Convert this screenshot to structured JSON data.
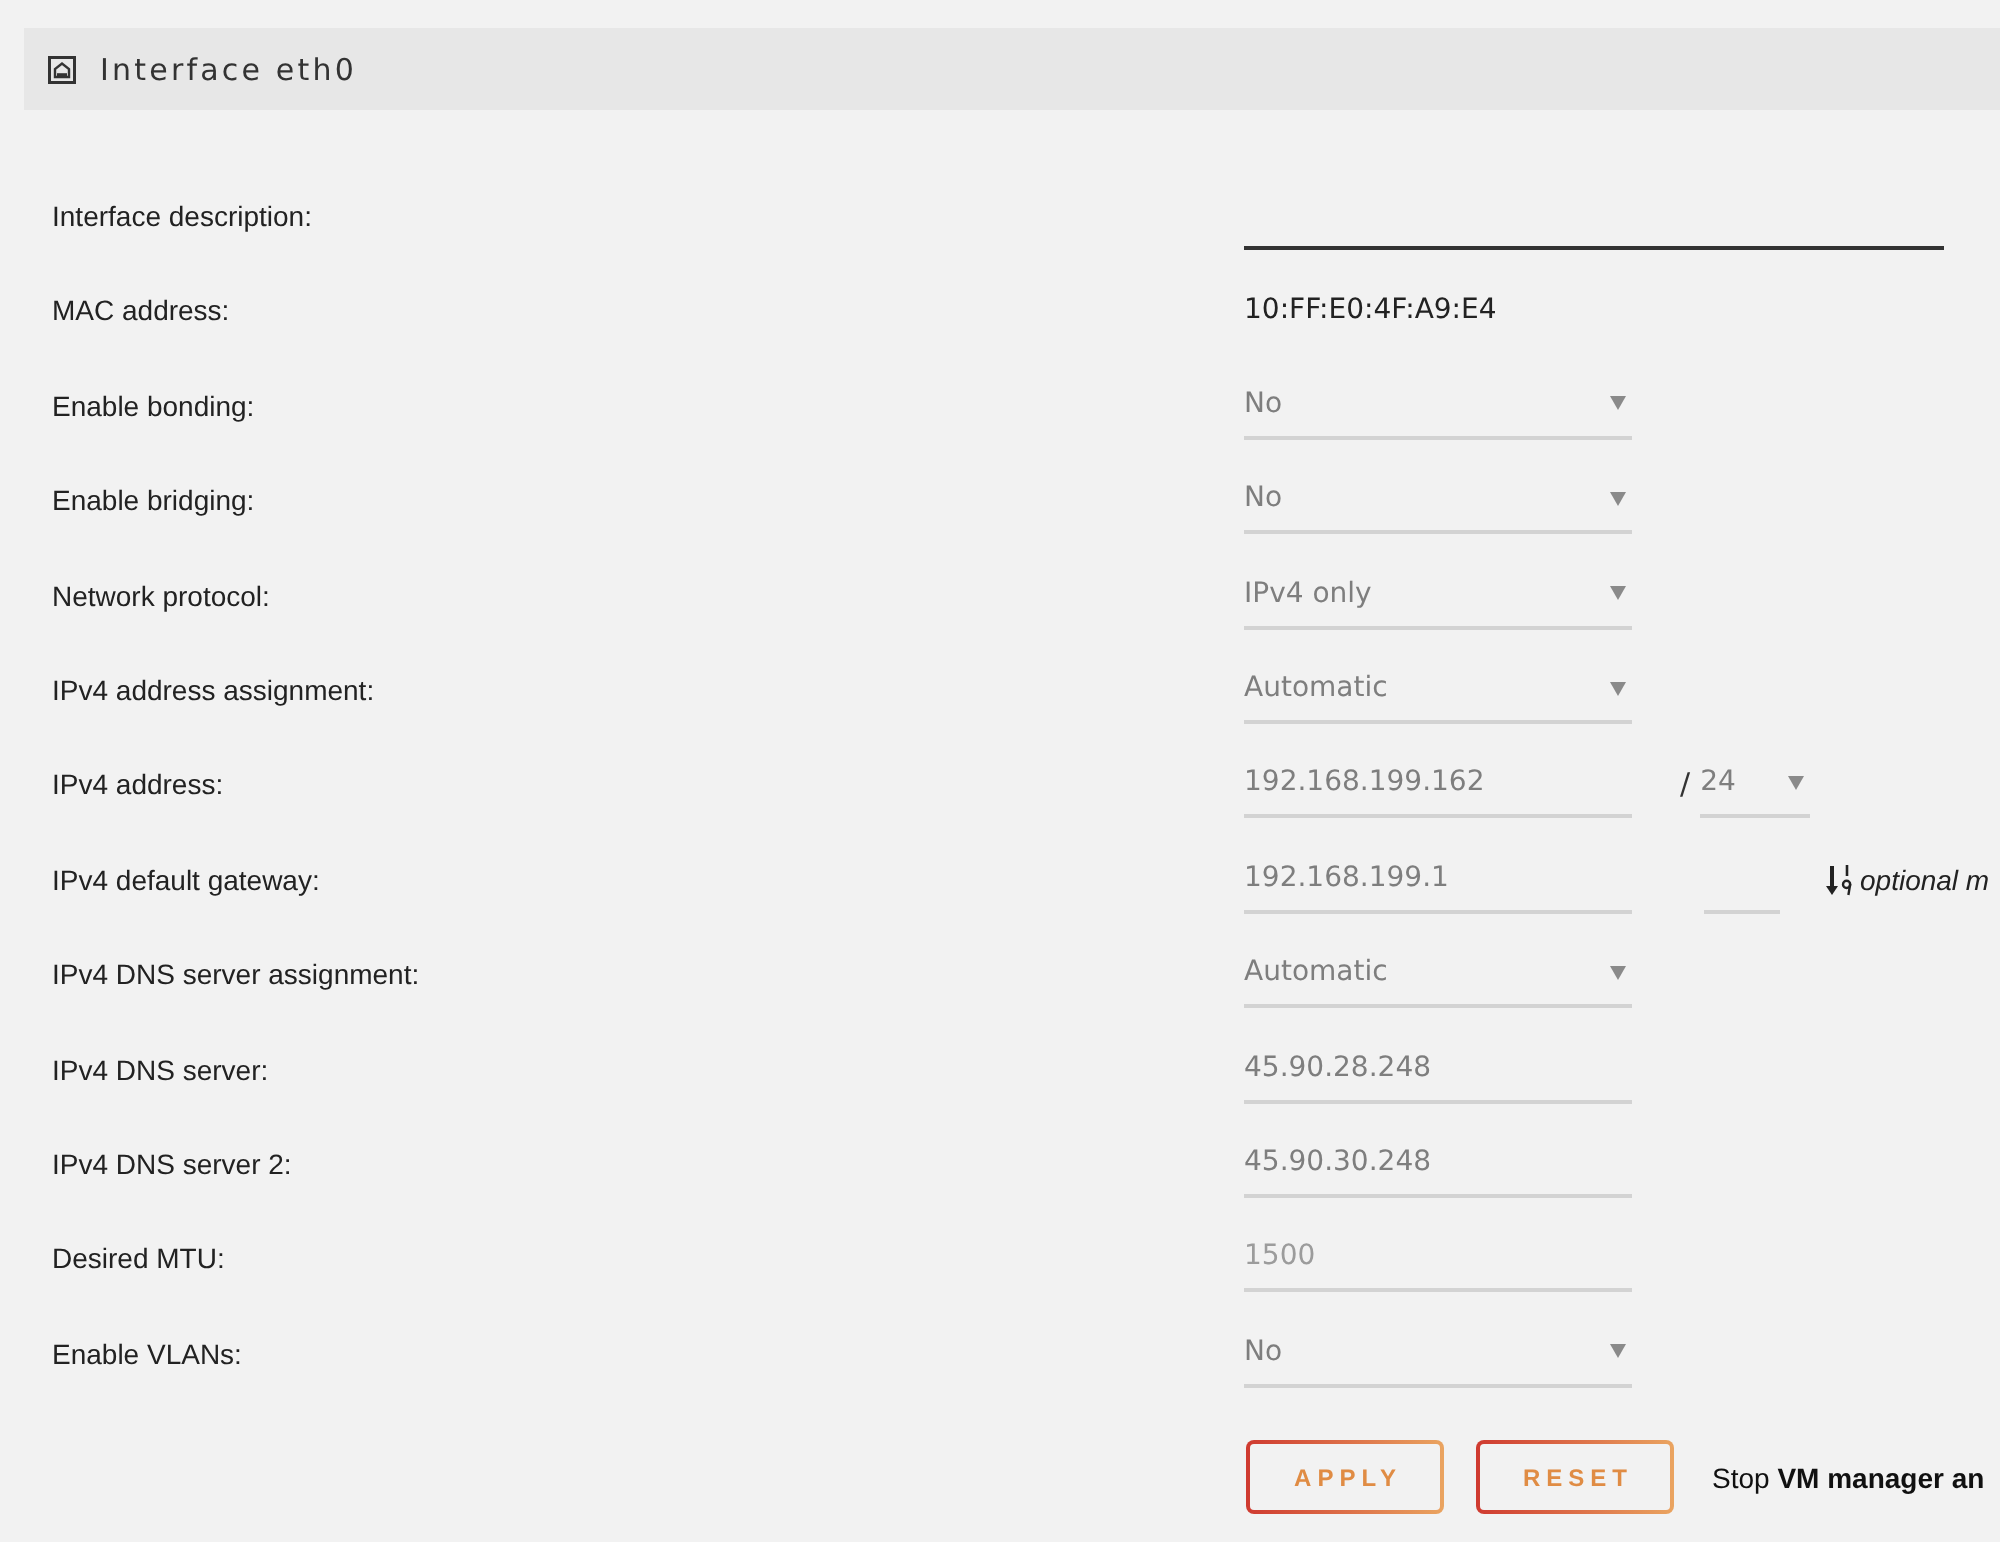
{
  "panel": {
    "title": "Interface eth0"
  },
  "settings": [
    {
      "label": "Interface description:",
      "controls": [
        {
          "kind": "wide-text",
          "disabled": false
        }
      ]
    },
    {
      "label": "MAC address:",
      "controls": [
        {
          "kind": "static",
          "value": "10:FF:E0:4F:A9:E4"
        }
      ]
    },
    {
      "label": "Enable bonding:",
      "controls": [
        {
          "kind": "select",
          "value": "No",
          "disabled": true
        }
      ]
    },
    {
      "label": "Enable bridging:",
      "controls": [
        {
          "kind": "select",
          "value": "No",
          "disabled": true
        }
      ]
    },
    {
      "label": "Network protocol:",
      "controls": [
        {
          "kind": "select",
          "value": "IPv4 only",
          "disabled": true
        }
      ]
    },
    {
      "label": "IPv4 address assignment:",
      "controls": [
        {
          "kind": "select",
          "value": "Automatic",
          "disabled": true
        }
      ]
    },
    {
      "label": "IPv4 address:",
      "controls": [
        {
          "kind": "text",
          "value": "192.168.199.162",
          "disabled": true
        },
        {
          "kind": "separator",
          "value": "/"
        },
        {
          "kind": "short-select",
          "value": "24",
          "disabled": true
        }
      ]
    },
    {
      "label": "IPv4 default gateway:",
      "controls": [
        {
          "kind": "text",
          "value": "192.168.199.1",
          "disabled": true
        },
        {
          "kind": "short-text",
          "disabled": true
        },
        {
          "kind": "hint",
          "value": "optional m"
        }
      ]
    },
    {
      "label": "IPv4 DNS server assignment:",
      "controls": [
        {
          "kind": "select",
          "value": "Automatic",
          "disabled": true
        }
      ]
    },
    {
      "label": "IPv4 DNS server:",
      "controls": [
        {
          "kind": "text",
          "value": "45.90.28.248",
          "disabled": true
        }
      ]
    },
    {
      "label": "IPv4 DNS server 2:",
      "controls": [
        {
          "kind": "text",
          "value": "45.90.30.248",
          "disabled": true
        }
      ]
    },
    {
      "label": "Desired MTU:",
      "controls": [
        {
          "kind": "text",
          "placeholder": "1500",
          "disabled": true
        }
      ]
    },
    {
      "label": "Enable VLANs:",
      "controls": [
        {
          "kind": "select",
          "value": "No",
          "disabled": true
        }
      ]
    }
  ],
  "actions": {
    "buttons": [
      {
        "label": "APPLY"
      },
      {
        "label": "RESET"
      }
    ],
    "message": "Stop **VM manager an**"
  }
}
